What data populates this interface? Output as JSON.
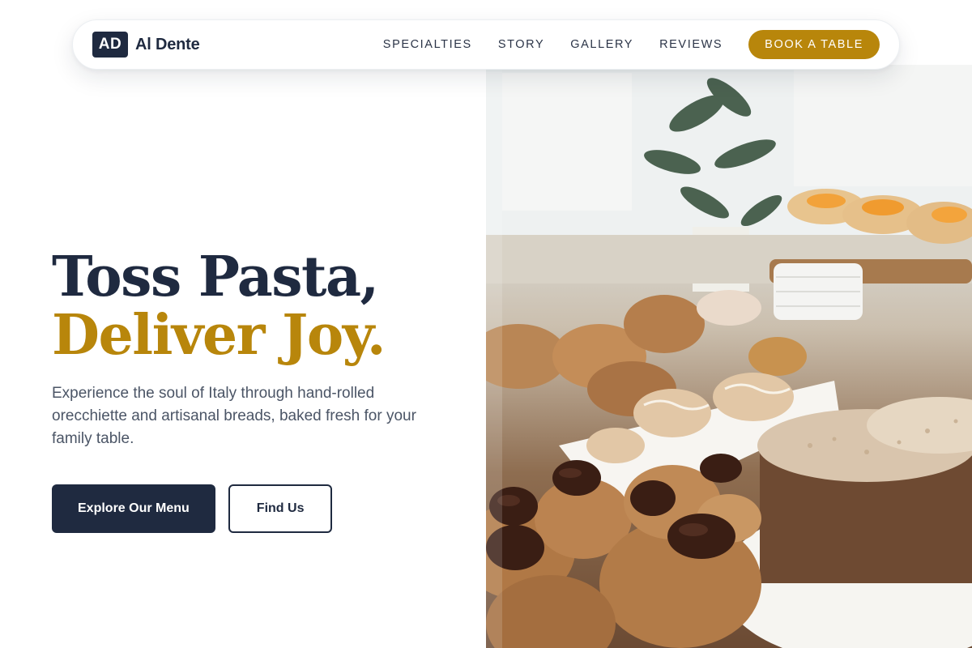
{
  "brand": {
    "badge": "AD",
    "name": "Al Dente"
  },
  "nav": {
    "links": [
      "SPECIALTIES",
      "STORY",
      "GALLERY",
      "REVIEWS"
    ],
    "cta_label": "BOOK A TABLE"
  },
  "hero": {
    "headline_line1": "Toss Pasta,",
    "headline_line2": "Deliver Joy.",
    "subtext": "Experience the soul of Italy through hand-rolled orecchiette and artisanal breads, baked fresh for your family table.",
    "primary_button": "Explore Our Menu",
    "secondary_button": "Find Us",
    "image_subject": "bakery-pastry-display-photo"
  },
  "colors": {
    "navy": "#1f2a40",
    "gold": "#b8860b",
    "body_text": "#4b5566",
    "background": "#ffffff"
  }
}
